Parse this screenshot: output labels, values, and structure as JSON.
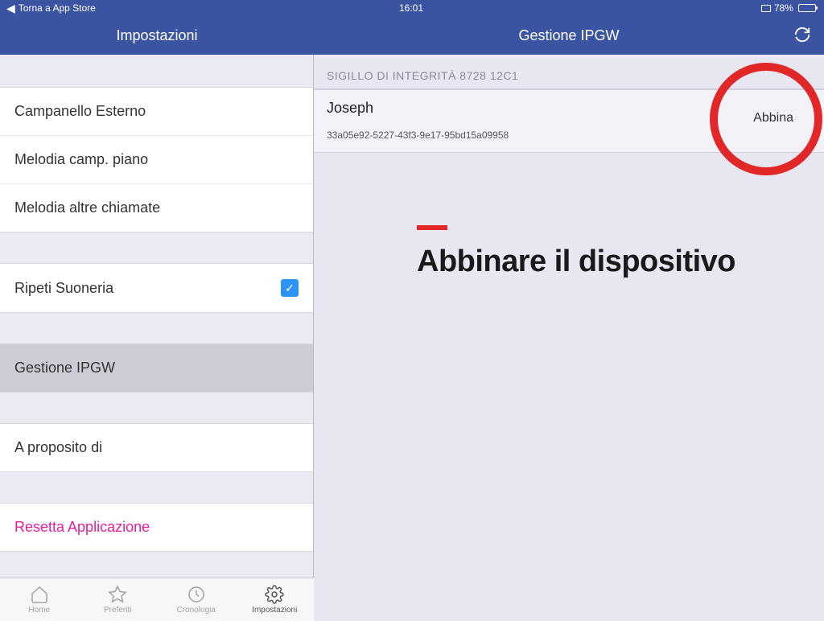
{
  "status": {
    "back_label": "Torna a App Store",
    "time": "16:01",
    "battery_pct": "78%"
  },
  "header": {
    "master_title": "Impostazioni",
    "detail_title": "Gestione IPGW"
  },
  "settings": {
    "group1": [
      {
        "label": "Campanello Esterno"
      },
      {
        "label": "Melodia camp. piano"
      },
      {
        "label": "Melodia altre chiamate"
      }
    ],
    "ripeti": {
      "label": "Ripeti Suoneria",
      "checked": true
    },
    "gestione": {
      "label": "Gestione IPGW"
    },
    "about": {
      "label": "A proposito di"
    },
    "reset": {
      "label": "Resetta Applicazione"
    }
  },
  "tabs": [
    {
      "label": "Home"
    },
    {
      "label": "Preferiti"
    },
    {
      "label": "Cronologia"
    },
    {
      "label": "Impostazioni"
    }
  ],
  "detail": {
    "section_header": "SIGILLO DI INTEGRITÀ 8728 12C1",
    "device_name": "Joseph",
    "device_uuid": "33a05e92-5227-43f3-9e17-95bd15a09958",
    "pair_button": "Abbina"
  },
  "overlay": {
    "title": "Abbinare il dispositivo"
  }
}
